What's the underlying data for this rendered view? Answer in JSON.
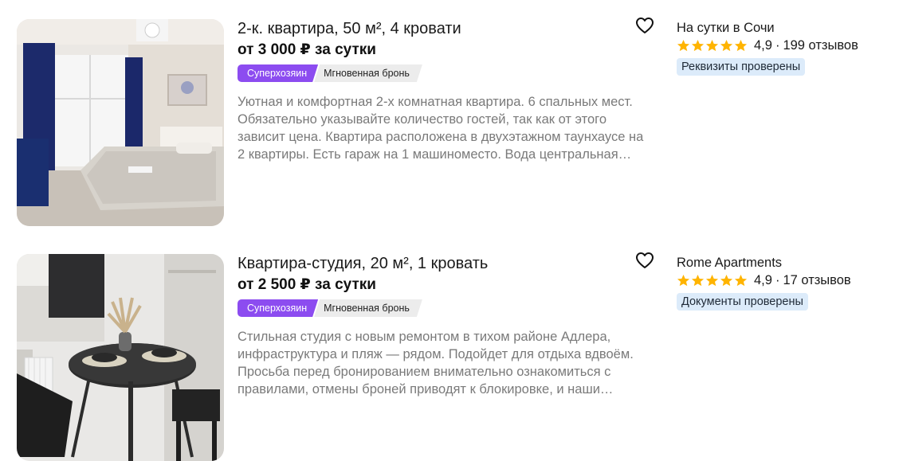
{
  "listings": [
    {
      "photo_description": "bedroom-photo",
      "title": "2-к. квартира, 50 м², 4 кровати",
      "price": "от 3 000 ₽ за сутки",
      "badges": {
        "superhost": "Суперхозяин",
        "instant": "Мгновенная бронь"
      },
      "description": "Уютная и комфортная 2-х комнатная квартира. 6 спальных мест. Обязательно указывайте количество гостей, так как от этого зависит цена. Квартира расположена в двухэтажном таунхаусе на 2 квартиры. Есть гараж на 1 машиноместо. Вода центральная…",
      "host": "На сутки в Сочи",
      "rating": "4,9",
      "rating_stars": 5,
      "reviews": "199 отзывов",
      "verified": "Реквизиты проверены"
    },
    {
      "photo_description": "studio-dining-photo",
      "title": "Квартира-студия, 20 м², 1 кровать",
      "price": "от 2 500 ₽ за сутки",
      "badges": {
        "superhost": "Суперхозяин",
        "instant": "Мгновенная бронь"
      },
      "description": "Стильная студия с новым ремонтом в тихом районе Адлера, инфраструктура и пляж — рядом. Подойдет для отдыха вдвоём. Просьба перед бронированием внимательно ознакомиться с правилами, отмены броней приводят к блокировке, и наши…",
      "host": "Rome Apartments",
      "rating": "4,9",
      "rating_stars": 5,
      "reviews": "17 отзывов",
      "verified": "Документы проверены"
    }
  ],
  "separator": "·",
  "icons": {
    "favorite": "heart-outline-icon",
    "star": "star-icon"
  },
  "colors": {
    "superhost_badge": "#8c4cf0",
    "instant_badge": "#ececec",
    "star": "#ffb400",
    "verified_bg": "#dcebfa",
    "description_text": "#7a7a7a"
  }
}
